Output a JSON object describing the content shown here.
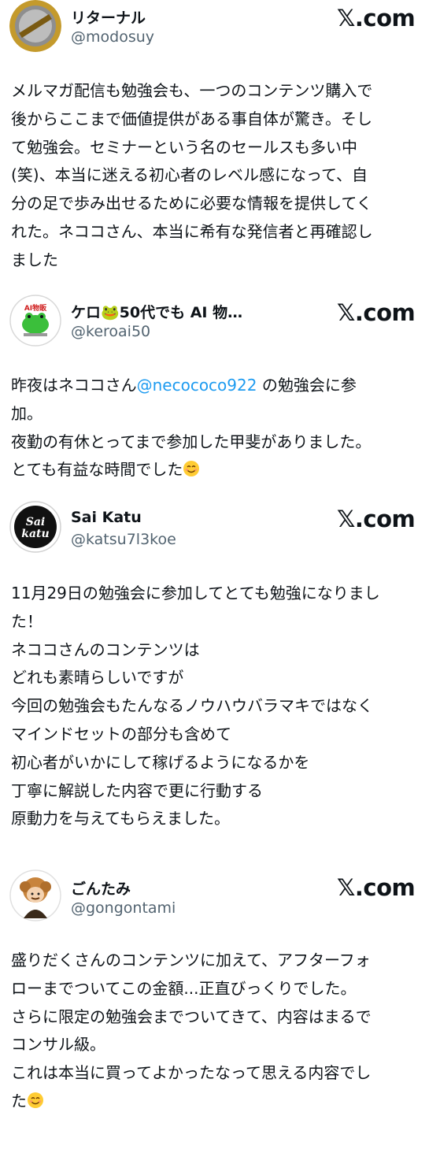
{
  "brand": {
    "x_logo": "𝕏",
    "domain": ".com"
  },
  "colors": {
    "link": "#1d9bf0",
    "handle": "#536471",
    "text": "#0f1419"
  },
  "tweets": [
    {
      "name": "リターナル",
      "handle": "@modosuy",
      "lines": [
        "メルマガ配信も勉強会も、一つのコンテンツ購入で",
        "後からここまで価値提供がある事自体が驚き。そし",
        "て勉強会。セミナーという名のセールスも多い中",
        "(笑)、本当に迷える初心者のレベル感になって、自",
        "分の足で歩み出せるために必要な情報を提供してく",
        "れた。ネココさん、本当に希有な発信者と再確認し",
        "ました"
      ]
    },
    {
      "name": "ケロ🐸50代でも AI 物…",
      "handle": "@keroai50",
      "avatar_text": "AI物販",
      "line1_pre": "昨夜はネココさん",
      "mention": "@necococo922",
      "line1_post": " の勉強会に参",
      "lines": [
        "加。",
        "夜勤の有休とってまで参加した甲斐がありました。",
        "とても有益な時間でした"
      ]
    },
    {
      "name": "Sai Katu",
      "handle": "@katsu7l3koe",
      "avatar_text": "Sai katu",
      "lines": [
        "11月29日の勉強会に参加してとても勉強になりまし",
        "た！",
        "",
        "ネココさんのコンテンツは",
        "どれも素晴らしいですが",
        "今回の勉強会もたんなるノウハウバラマキではなく",
        "マインドセットの部分も含めて",
        "初心者がいかにして稼げるようになるかを",
        "丁寧に解説した内容で更に行動する",
        "原動力を与えてもらえました。"
      ]
    },
    {
      "name": "ごんたみ",
      "handle": "@gongontami",
      "lines": [
        "盛りだくさんのコンテンツに加えて、アフターフォ",
        "ローまでついてこの金額...正直びっくりでした。",
        "",
        "さらに限定の勉強会までついてきて、内容はまるで",
        "コンサル級。",
        "これは本当に買ってよかったなって思える内容でし",
        "た"
      ]
    }
  ]
}
